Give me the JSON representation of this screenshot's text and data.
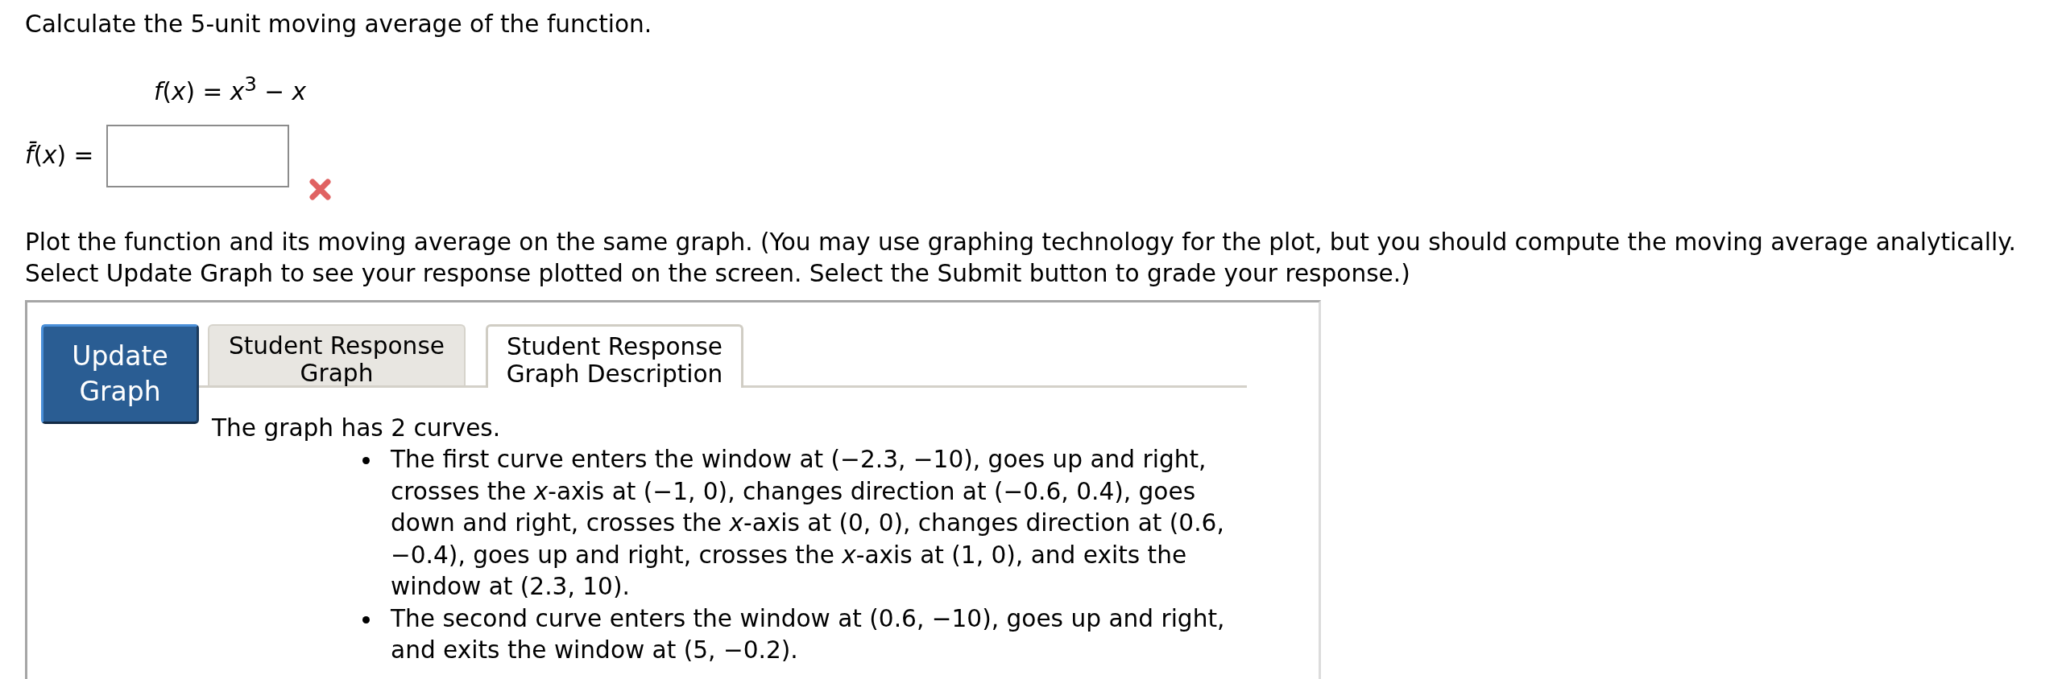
{
  "question": {
    "prompt": "Calculate the 5-unit moving average of the function.",
    "function": "*f*(*x*) = *x*$^{3}$ − *x*"
  },
  "answer": {
    "label": "*f̄*(*x*) =",
    "correct": false
  },
  "instructions": "Plot the function and its moving average on the same graph. (You may use graphing technology for the plot, but you should compute the moving average analytically. Select Update Graph to see your response plotted on the screen. Select the Submit button to grade your response.)",
  "graph": {
    "button": "Update Graph",
    "tabs": [
      {
        "label": "Student Response Graph",
        "selected": false
      },
      {
        "label": "Student Response Graph Description",
        "selected": true
      }
    ],
    "description": {
      "summary": "The graph has 2 curves.",
      "items": [
        "The first curve enters the window at (−2.3, −10), goes up and right, crosses the *x*-axis at (−1, 0), changes direction at (−0.6, 0.4), goes down and right, crosses the *x*-axis at (0, 0), changes direction at (0.6, −0.4), goes up and right, crosses the *x*-axis at (1, 0), and exits the window at (2.3, 10).",
        "The second curve enters the window at (0.6, −10), goes up and right, and exits the window at (5, −0.2)."
      ]
    }
  }
}
